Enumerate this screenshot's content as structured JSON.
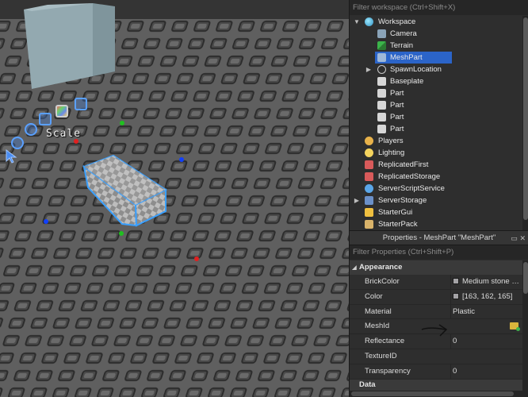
{
  "viewport": {
    "tool_label": "Scale"
  },
  "explorer": {
    "filter_placeholder": "Filter workspace (Ctrl+Shift+X)",
    "items": [
      {
        "label": "Workspace",
        "icon": "workspace-globe-icon"
      },
      {
        "label": "Camera",
        "icon": "camera-icon"
      },
      {
        "label": "Terrain",
        "icon": "terrain-icon"
      },
      {
        "label": "MeshPart",
        "icon": "meshpart-icon",
        "selected": true
      },
      {
        "label": "SpawnLocation",
        "icon": "spawn-location-icon"
      },
      {
        "label": "Baseplate",
        "icon": "part-icon"
      },
      {
        "label": "Part",
        "icon": "part-icon"
      },
      {
        "label": "Part",
        "icon": "part-icon"
      },
      {
        "label": "Part",
        "icon": "part-icon"
      },
      {
        "label": "Part",
        "icon": "part-icon"
      },
      {
        "label": "Players",
        "icon": "players-icon"
      },
      {
        "label": "Lighting",
        "icon": "lighting-bulb-icon"
      },
      {
        "label": "ReplicatedFirst",
        "icon": "replicated-first-icon"
      },
      {
        "label": "ReplicatedStorage",
        "icon": "replicated-storage-icon"
      },
      {
        "label": "ServerScriptService",
        "icon": "server-script-service-icon"
      },
      {
        "label": "ServerStorage",
        "icon": "server-storage-icon"
      },
      {
        "label": "StarterGui",
        "icon": "starter-gui-icon"
      },
      {
        "label": "StarterPack",
        "icon": "starter-pack-icon"
      }
    ]
  },
  "properties": {
    "title": "Properties - MeshPart \"MeshPart\"",
    "filter_placeholder": "Filter Properties (Ctrl+Shift+P)",
    "section": "Appearance",
    "rows": [
      {
        "name": "BrickColor",
        "value": "Medium stone grey",
        "swatch": "#a3a2a5"
      },
      {
        "name": "Color",
        "value": "[163, 162, 165]",
        "swatch": "#a3a2a5"
      },
      {
        "name": "Material",
        "value": "Plastic"
      },
      {
        "name": "MeshId",
        "value": ""
      },
      {
        "name": "Reflectance",
        "value": "0"
      },
      {
        "name": "TextureID",
        "value": ""
      },
      {
        "name": "Transparency",
        "value": "0"
      }
    ],
    "next_section": "Data"
  }
}
